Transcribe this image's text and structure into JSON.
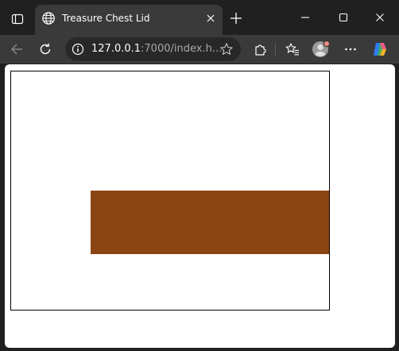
{
  "window": {
    "tab": {
      "title": "Treasure Chest Lid",
      "favicon": "globe-icon"
    },
    "icons": {
      "tab_actions": "tab-actions-icon",
      "tab_close": "close-icon",
      "new_tab": "plus-icon",
      "minimize": "minimize-icon",
      "maximize": "maximize-icon",
      "close": "close-icon"
    }
  },
  "toolbar": {
    "address": {
      "host": "127.0.0.1",
      "rest": ":7000/index.h..."
    },
    "icons": {
      "back": "back-arrow-icon",
      "reload": "reload-icon",
      "site_info": "info-icon",
      "favorite": "star-icon",
      "extensions": "puzzle-icon",
      "favorites": "favorites-icon",
      "profile": "avatar",
      "more": "more-icon",
      "copilot": "copilot-icon"
    }
  },
  "page": {
    "lid": {
      "color": "#8B4513"
    },
    "canvas_border_color": "#000000",
    "background_color": "#ffffff"
  }
}
